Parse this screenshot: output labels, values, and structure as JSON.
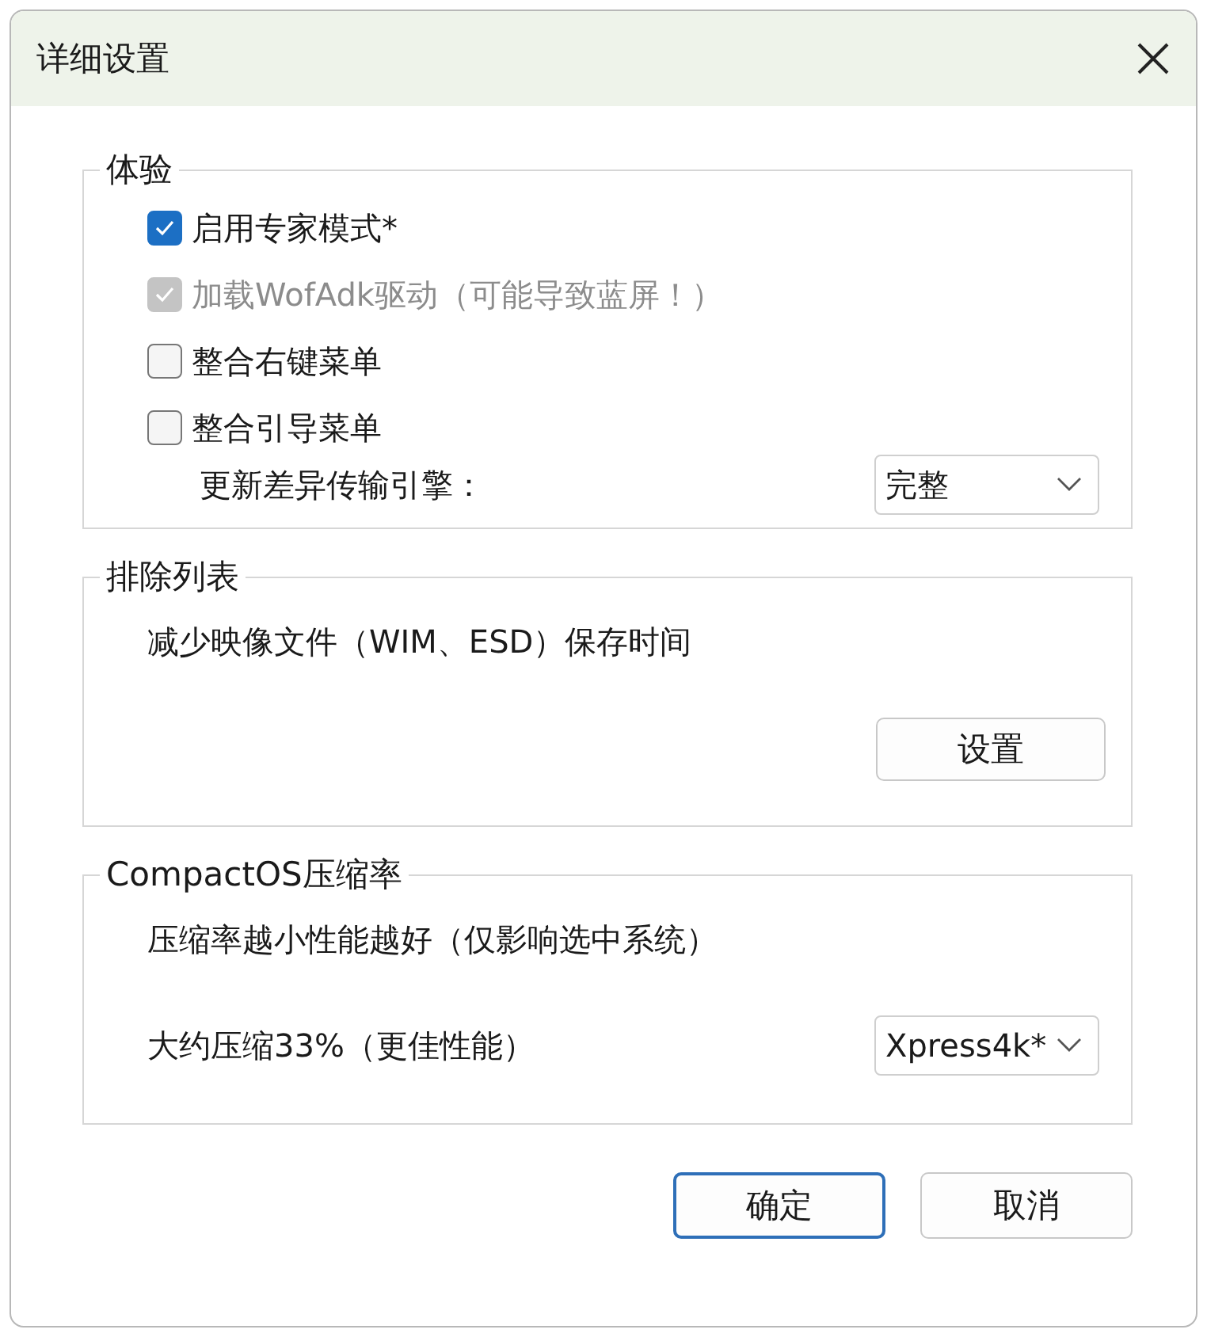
{
  "window": {
    "title": "详细设置"
  },
  "experience": {
    "title": "体验",
    "checkboxes": [
      {
        "label": "启用专家模式*",
        "checked": true,
        "disabled": false
      },
      {
        "label": "加载WofAdk驱动（可能导致蓝屏！）",
        "checked": true,
        "disabled": true
      },
      {
        "label": "整合右键菜单",
        "checked": false,
        "disabled": false
      },
      {
        "label": "整合引导菜单",
        "checked": false,
        "disabled": false
      }
    ],
    "engine": {
      "label": "更新差异传输引擎：",
      "value": "完整"
    }
  },
  "exclusion": {
    "title": "排除列表",
    "description": "减少映像文件（WIM、ESD）保存时间",
    "button": "设置"
  },
  "compact": {
    "title": "CompactOS压缩率",
    "description": "压缩率越小性能越好（仅影响选中系统）",
    "option_label": "大约压缩33%（更佳性能）",
    "value": "Xpress4k*"
  },
  "buttons": [
    {
      "label": "确定",
      "default": true
    },
    {
      "label": "取消",
      "default": false
    }
  ]
}
